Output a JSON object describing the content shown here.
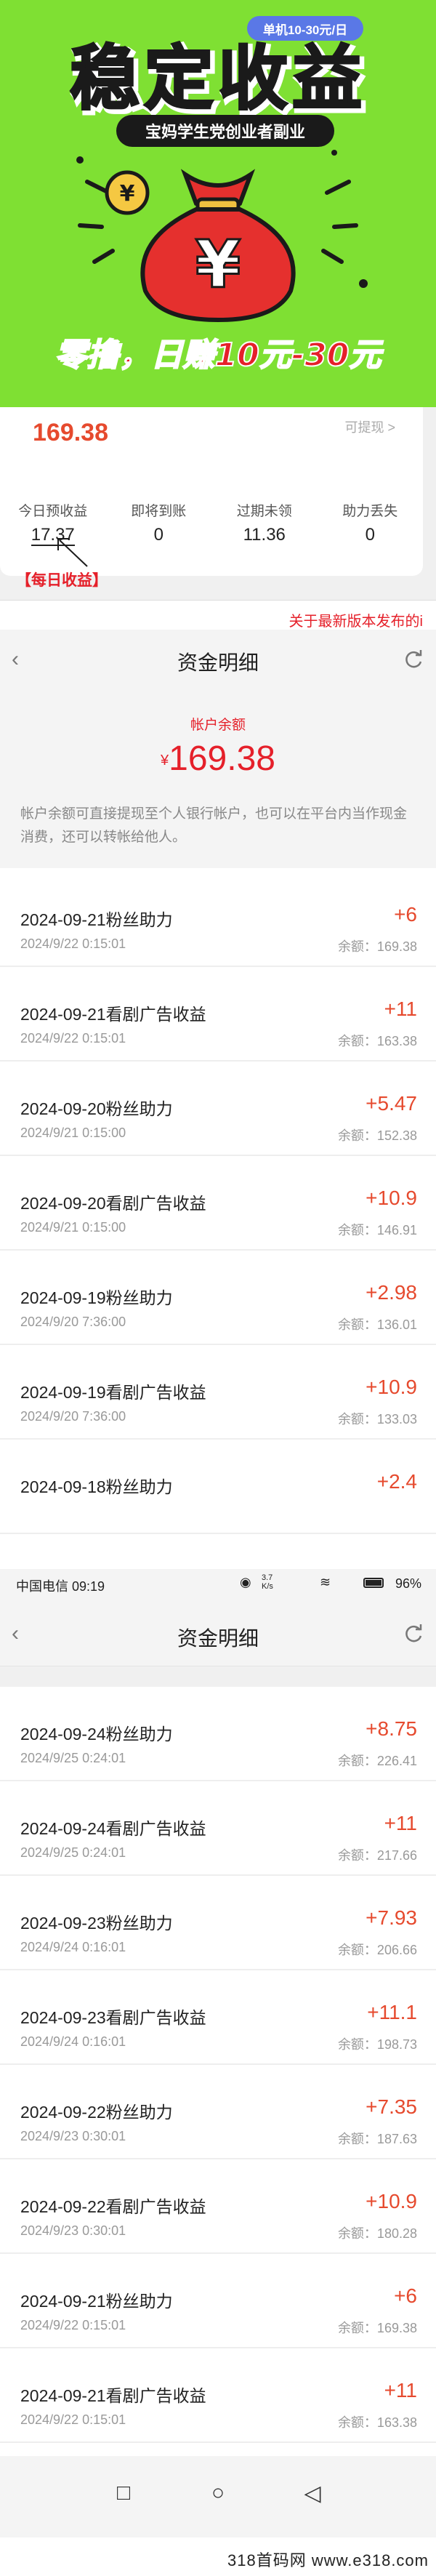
{
  "banner": {
    "badge": "单机10-30元/日",
    "title": "稳定收益",
    "subtitle": "宝妈学生党创业者副业",
    "slogan": "零撸，日赚10元-30元",
    "colors": {
      "bg": "#7fe033",
      "bag": "#e5302e",
      "badge": "#5a78e6"
    }
  },
  "wallet_card": {
    "balance": "169.38",
    "withdraw_label": "可提现",
    "withdraw_arrow": ">",
    "stats": [
      {
        "label": "今日预收益",
        "value": "17.37"
      },
      {
        "label": "即将到账",
        "value": "0"
      },
      {
        "label": "过期未领",
        "value": "11.36"
      },
      {
        "label": "助力丢失",
        "value": "0"
      }
    ],
    "daily_label": "【每日收益】",
    "notice": "关于最新版本发布的i"
  },
  "screen1": {
    "nav": {
      "back": "‹",
      "title": "资金明细"
    },
    "balance_label": "帐户余额",
    "currency": "¥",
    "balance": "169.38",
    "note": "帐户余额可直接提现至个人银行帐户，也可以在平台内当作现金消费，还可以转帐给他人。",
    "rows": [
      {
        "name": "2024-09-21粉丝助力",
        "date": "2024/9/22 0:15:01",
        "delta": "+6",
        "balance": "余额：169.38"
      },
      {
        "name": "2024-09-21看剧广告收益",
        "date": "2024/9/22 0:15:01",
        "delta": "+11",
        "balance": "余额：163.38"
      },
      {
        "name": "2024-09-20粉丝助力",
        "date": "2024/9/21 0:15:00",
        "delta": "+5.47",
        "balance": "余额：152.38"
      },
      {
        "name": "2024-09-20看剧广告收益",
        "date": "2024/9/21 0:15:00",
        "delta": "+10.9",
        "balance": "余额：146.91"
      },
      {
        "name": "2024-09-19粉丝助力",
        "date": "2024/9/20 7:36:00",
        "delta": "+2.98",
        "balance": "余额：136.01"
      },
      {
        "name": "2024-09-19看剧广告收益",
        "date": "2024/9/20 7:36:00",
        "delta": "+10.9",
        "balance": "余额：133.03"
      },
      {
        "name": "2024-09-18粉丝助力",
        "date": "",
        "delta": "+2.4",
        "balance": ""
      }
    ]
  },
  "status_bar": {
    "left": "中国电信 09:19",
    "right": "96%",
    "speed": "3.7 K/s"
  },
  "screen2": {
    "nav": {
      "back": "‹",
      "title": "资金明细"
    },
    "rows": [
      {
        "name": "2024-09-24粉丝助力",
        "date": "2024/9/25 0:24:01",
        "delta": "+8.75",
        "balance": "余额：226.41"
      },
      {
        "name": "2024-09-24看剧广告收益",
        "date": "2024/9/25 0:24:01",
        "delta": "+11",
        "balance": "余额：217.66"
      },
      {
        "name": "2024-09-23粉丝助力",
        "date": "2024/9/24 0:16:01",
        "delta": "+7.93",
        "balance": "余额：206.66"
      },
      {
        "name": "2024-09-23看剧广告收益",
        "date": "2024/9/24 0:16:01",
        "delta": "+11.1",
        "balance": "余额：198.73"
      },
      {
        "name": "2024-09-22粉丝助力",
        "date": "2024/9/23 0:30:01",
        "delta": "+7.35",
        "balance": "余额：187.63"
      },
      {
        "name": "2024-09-22看剧广告收益",
        "date": "2024/9/23 0:30:01",
        "delta": "+10.9",
        "balance": "余额：180.28"
      },
      {
        "name": "2024-09-21粉丝助力",
        "date": "2024/9/22 0:15:01",
        "delta": "+6",
        "balance": "余额：169.38"
      },
      {
        "name": "2024-09-21看剧广告收益",
        "date": "2024/9/22 0:15:01",
        "delta": "+11",
        "balance": "余额：163.38"
      }
    ]
  },
  "system_nav": {
    "square": "□",
    "circle": "○",
    "back": "◁"
  },
  "footer": {
    "text": "318首码网  www.e318.com"
  }
}
